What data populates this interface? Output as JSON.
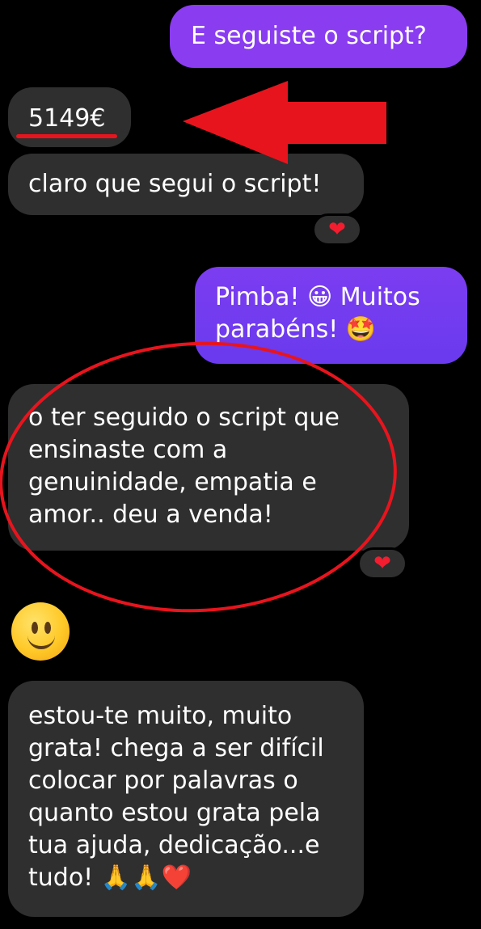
{
  "messages": [
    {
      "id": "m1",
      "direction": "outgoing",
      "text": "E seguiste o script?"
    },
    {
      "id": "m2",
      "direction": "incoming",
      "text": "5149€"
    },
    {
      "id": "m3",
      "direction": "incoming",
      "text": "claro que segui o script!"
    },
    {
      "id": "m4",
      "direction": "outgoing",
      "text": "Pimba! 😀 Muitos\nparabéns! 🤩"
    },
    {
      "id": "m5",
      "direction": "incoming",
      "text": "o ter seguido o script que\nensinaste com a\ngenuinidade, empatia e\namor.. deu a venda!"
    },
    {
      "id": "m6",
      "direction": "incoming",
      "emoji": "slightly-smiling-face"
    },
    {
      "id": "m7",
      "direction": "incoming",
      "text": "estou-te muito, muito\ngrata! chega a ser difícil\ncolocar por palavras o\nquanto estou grata pela\ntua ajuda, dedicação...e\ntudo! 🙏🙏❤️"
    }
  ],
  "reactions": {
    "m3": "❤",
    "m5": "❤"
  },
  "annotations": {
    "color": "#e8141d",
    "shapes": [
      "underline",
      "arrow",
      "ellipse"
    ]
  },
  "colors": {
    "outgoing_bubble": "#8a3cf0",
    "incoming_bubble": "#2f2f2f",
    "background": "#000000",
    "heart": "#f31d2f"
  }
}
